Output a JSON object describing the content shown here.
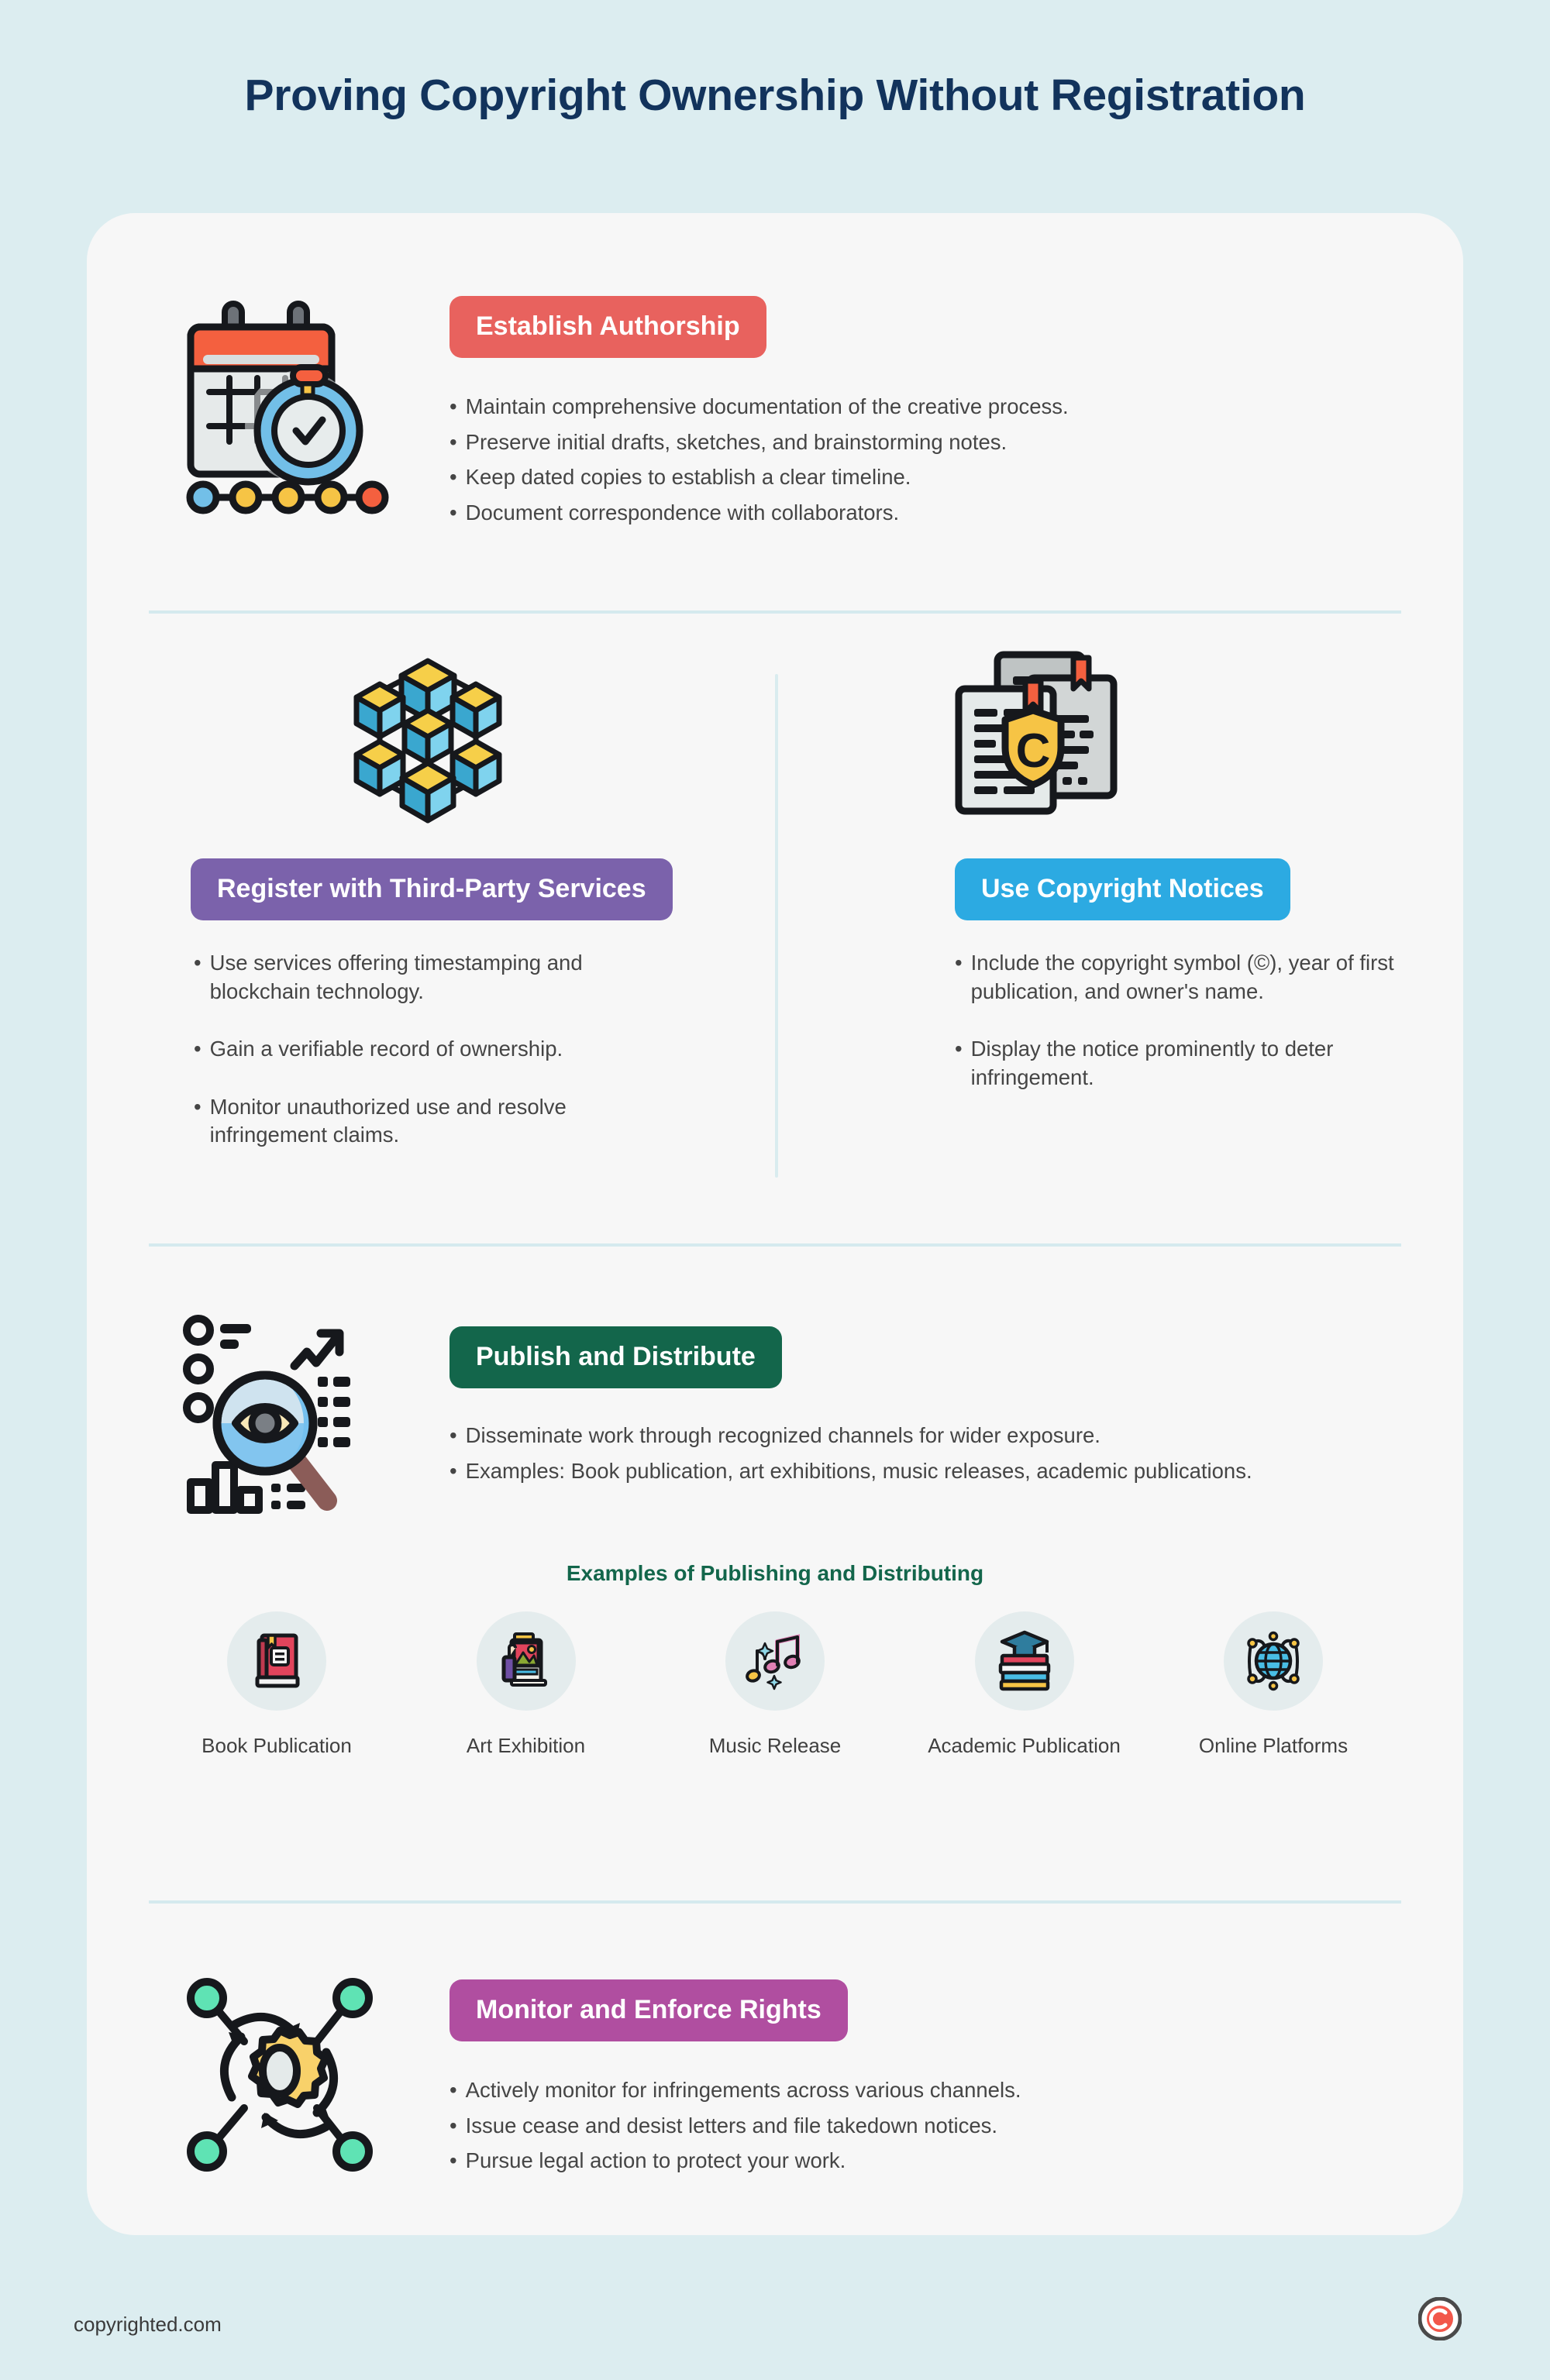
{
  "page": {
    "title": "Proving Copyright Ownership Without Registration",
    "bg_color": "#dcedf0",
    "card_color": "#f7f7f7",
    "title_color": "#12335c"
  },
  "sections": {
    "establish": {
      "pill_label": "Establish Authorship",
      "pill_color": "#e8625e",
      "icon_name": "calendar-stopwatch-timeline-icon",
      "bullets": [
        "Maintain comprehensive documentation of the creative process.",
        "Preserve initial drafts, sketches, and brainstorming notes.",
        "Keep dated copies to establish a clear timeline.",
        "Document correspondence with collaborators."
      ]
    },
    "register": {
      "pill_label": "Register with Third-Party Services",
      "pill_color": "#7b62ab",
      "icon_name": "blockchain-cubes-icon",
      "bullets": [
        "Use services offering timestamping and blockchain technology.",
        "Gain a verifiable record of ownership.",
        "Monitor unauthorized use and resolve infringement claims."
      ]
    },
    "notices": {
      "pill_label": "Use Copyright Notices",
      "pill_color": "#2caae2",
      "icon_name": "documents-copyright-shield-icon",
      "bullets": [
        "Include the copyright symbol (©), year of first publication, and owner's name.",
        "Display the notice prominently to deter infringement."
      ]
    },
    "publish": {
      "pill_label": "Publish and Distribute",
      "pill_color": "#13664b",
      "icon_name": "magnifier-eye-analytics-icon",
      "bullets": [
        "Disseminate work through recognized channels for wider exposure.",
        "Examples: Book publication, art exhibitions, music releases, academic publications."
      ],
      "examples_title": "Examples of Publishing and Distributing",
      "examples": [
        {
          "label": "Book Publication",
          "icon_name": "red-book-icon"
        },
        {
          "label": "Art Exhibition",
          "icon_name": "art-frame-easel-icon"
        },
        {
          "label": "Music Release",
          "icon_name": "music-notes-icon"
        },
        {
          "label": "Academic Publication",
          "icon_name": "graduation-books-icon"
        },
        {
          "label": "Online Platforms",
          "icon_name": "globe-network-icon"
        }
      ]
    },
    "monitor": {
      "pill_label": "Monitor and Enforce Rights",
      "pill_color": "#b04ea0",
      "icon_name": "gear-network-cycle-icon",
      "bullets": [
        "Actively monitor for infringements across various channels.",
        "Issue cease and desist letters and file takedown notices.",
        "Pursue legal action to protect your work."
      ]
    }
  },
  "footer": {
    "site": "copyrighted.com",
    "logo_name": "copyrighted-c-logo",
    "logo_color": "#f2574a"
  }
}
